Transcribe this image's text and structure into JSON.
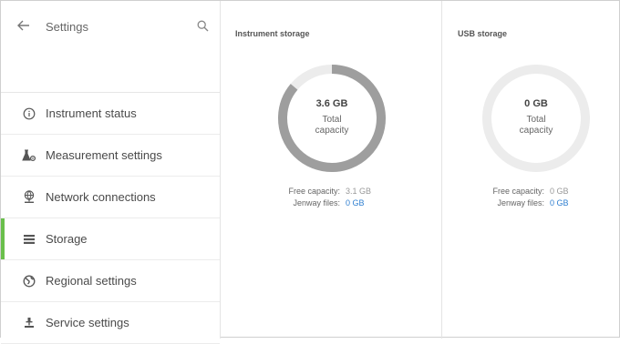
{
  "sidebar": {
    "title": "Settings",
    "items": [
      {
        "label": "Instrument status",
        "icon": "info-icon"
      },
      {
        "label": "Measurement settings",
        "icon": "flask-gear-icon"
      },
      {
        "label": "Network connections",
        "icon": "network-globe-icon"
      },
      {
        "label": "Storage",
        "icon": "storage-list-icon",
        "active": true
      },
      {
        "label": "Regional settings",
        "icon": "globe-icon"
      },
      {
        "label": "Service settings",
        "icon": "service-icon"
      }
    ]
  },
  "instrument": {
    "title": "Instrument storage",
    "total_value": "3.6 GB",
    "total_label_line1": "Total",
    "total_label_line2": "capacity",
    "free_label": "Free capacity:",
    "free_value": "3.1 GB",
    "files_label": "Jenway files:",
    "files_value": "0 GB",
    "used_fraction": 0.86
  },
  "usb": {
    "title": "USB storage",
    "total_value": "0 GB",
    "total_label_line1": "Total",
    "total_label_line2": "capacity",
    "free_label": "Free capacity:",
    "free_value": "0 GB",
    "files_label": "Jenway files:",
    "files_value": "0 GB",
    "used_fraction": 0
  },
  "colors": {
    "accent_active": "#6abf4b",
    "ring_used": "#9e9e9e",
    "ring_free": "#ececec",
    "value_blue": "#2f7fd0"
  }
}
